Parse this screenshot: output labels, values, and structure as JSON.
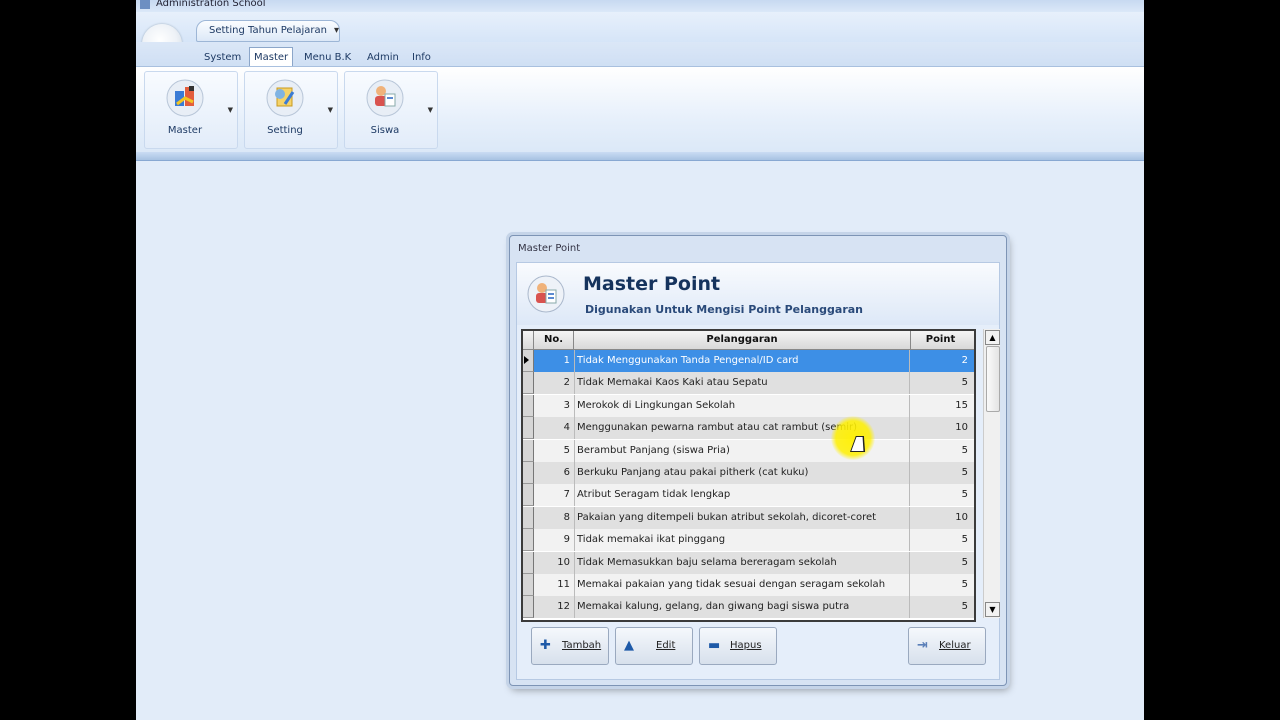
{
  "window": {
    "title": "Administration School"
  },
  "qat": {
    "tab_label": "Setting Tahun Pelajaran",
    "dropdown": "▾"
  },
  "menu_tabs": [
    {
      "label": "System"
    },
    {
      "label": "Master"
    },
    {
      "label": "Menu B.K"
    },
    {
      "label": "Admin"
    },
    {
      "label": "Info"
    }
  ],
  "active_tab": "Master",
  "ribbon": {
    "buttons": [
      {
        "label": "Master",
        "icon": "master-icon"
      },
      {
        "label": "Setting",
        "icon": "setting-icon"
      },
      {
        "label": "Siswa",
        "icon": "siswa-icon"
      }
    ]
  },
  "dialog": {
    "caption": "Master Point",
    "title": "Master Point",
    "subtitle": "Digunakan Untuk Mengisi Point Pelanggaran",
    "columns": {
      "no": "No.",
      "pelanggaran": "Pelanggaran",
      "point": "Point"
    },
    "rows": [
      {
        "no": "1",
        "pelanggaran": "Tidak Menggunakan Tanda Pengenal/ID card",
        "point": "2"
      },
      {
        "no": "2",
        "pelanggaran": "Tidak Memakai Kaos Kaki atau Sepatu",
        "point": "5"
      },
      {
        "no": "3",
        "pelanggaran": "Merokok di Lingkungan Sekolah",
        "point": "15"
      },
      {
        "no": "4",
        "pelanggaran": "Menggunakan pewarna rambut atau cat rambut (semir)",
        "point": "10"
      },
      {
        "no": "5",
        "pelanggaran": "Berambut Panjang (siswa Pria)",
        "point": "5"
      },
      {
        "no": "6",
        "pelanggaran": "Berkuku Panjang atau pakai pitherk (cat kuku)",
        "point": "5"
      },
      {
        "no": "7",
        "pelanggaran": "Atribut Seragam tidak lengkap",
        "point": "5"
      },
      {
        "no": "8",
        "pelanggaran": "Pakaian yang ditempeli bukan atribut sekolah, dicoret-coret",
        "point": "10"
      },
      {
        "no": "9",
        "pelanggaran": "Tidak memakai ikat pinggang",
        "point": "5"
      },
      {
        "no": "10",
        "pelanggaran": "Tidak Memasukkan baju selama bereragam sekolah",
        "point": "5"
      },
      {
        "no": "11",
        "pelanggaran": "Memakai pakaian yang tidak sesuai dengan seragam sekolah",
        "point": "5"
      },
      {
        "no": "12",
        "pelanggaran": "Memakai kalung, gelang, dan giwang bagi siswa putra",
        "point": "5"
      }
    ],
    "selected_row": 1,
    "buttons": {
      "tambah": "Tambah",
      "edit": "Edit",
      "hapus": "Hapus",
      "keluar": "Keluar"
    }
  },
  "colors": {
    "selection": "#3d8fe6",
    "title_text": "#15335d"
  }
}
